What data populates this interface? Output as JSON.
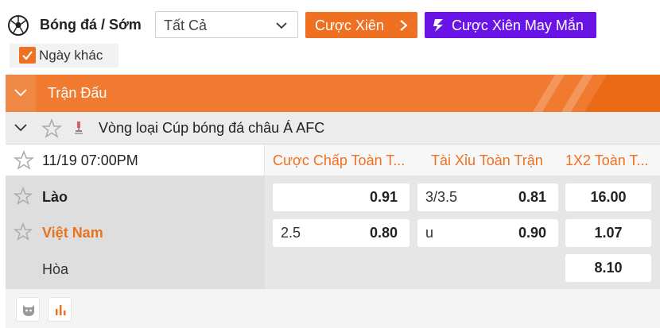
{
  "filter": {
    "sport_title": "Bóng đá / Sớm",
    "market_select": "Tất Cả",
    "parlay_button": "Cược Xiên",
    "lucky_parlay_button": "Cược Xiên May Mắn",
    "other_days_label": "Ngày khác",
    "other_days_checked": true
  },
  "section_header": {
    "title": "Trận Đấu"
  },
  "league": {
    "name": "Vòng loại Cúp bóng đá châu Á AFC"
  },
  "match": {
    "datetime": "11/19 07:00PM",
    "columns": [
      "Cược Chấp Toàn T...",
      "Tài Xỉu Toàn Trận",
      "1X2 Toàn T..."
    ],
    "teams": {
      "home": "Lào",
      "away": "Việt Nam",
      "draw": "Hòa"
    },
    "odds": {
      "handicap": [
        {
          "line": "",
          "price": "0.91"
        },
        {
          "line": "2.5",
          "price": "0.80"
        }
      ],
      "over_under": [
        {
          "line": "3/3.5",
          "price": "0.81"
        },
        {
          "line": "u",
          "price": "0.90"
        }
      ],
      "one_x_two": [
        "16.00",
        "1.07",
        "8.10"
      ]
    }
  },
  "colors": {
    "accent": "#f07021",
    "lucky": "#6a13e6",
    "header": "#ef7a30",
    "away_team": "#e8731f"
  },
  "icons": [
    "soccer-ball-icon",
    "chevron-down-icon",
    "chevron-right-icon",
    "lightning-icon",
    "checkbox-icon",
    "star-icon",
    "trophy-icon",
    "stats-icon",
    "mascot-icon"
  ]
}
